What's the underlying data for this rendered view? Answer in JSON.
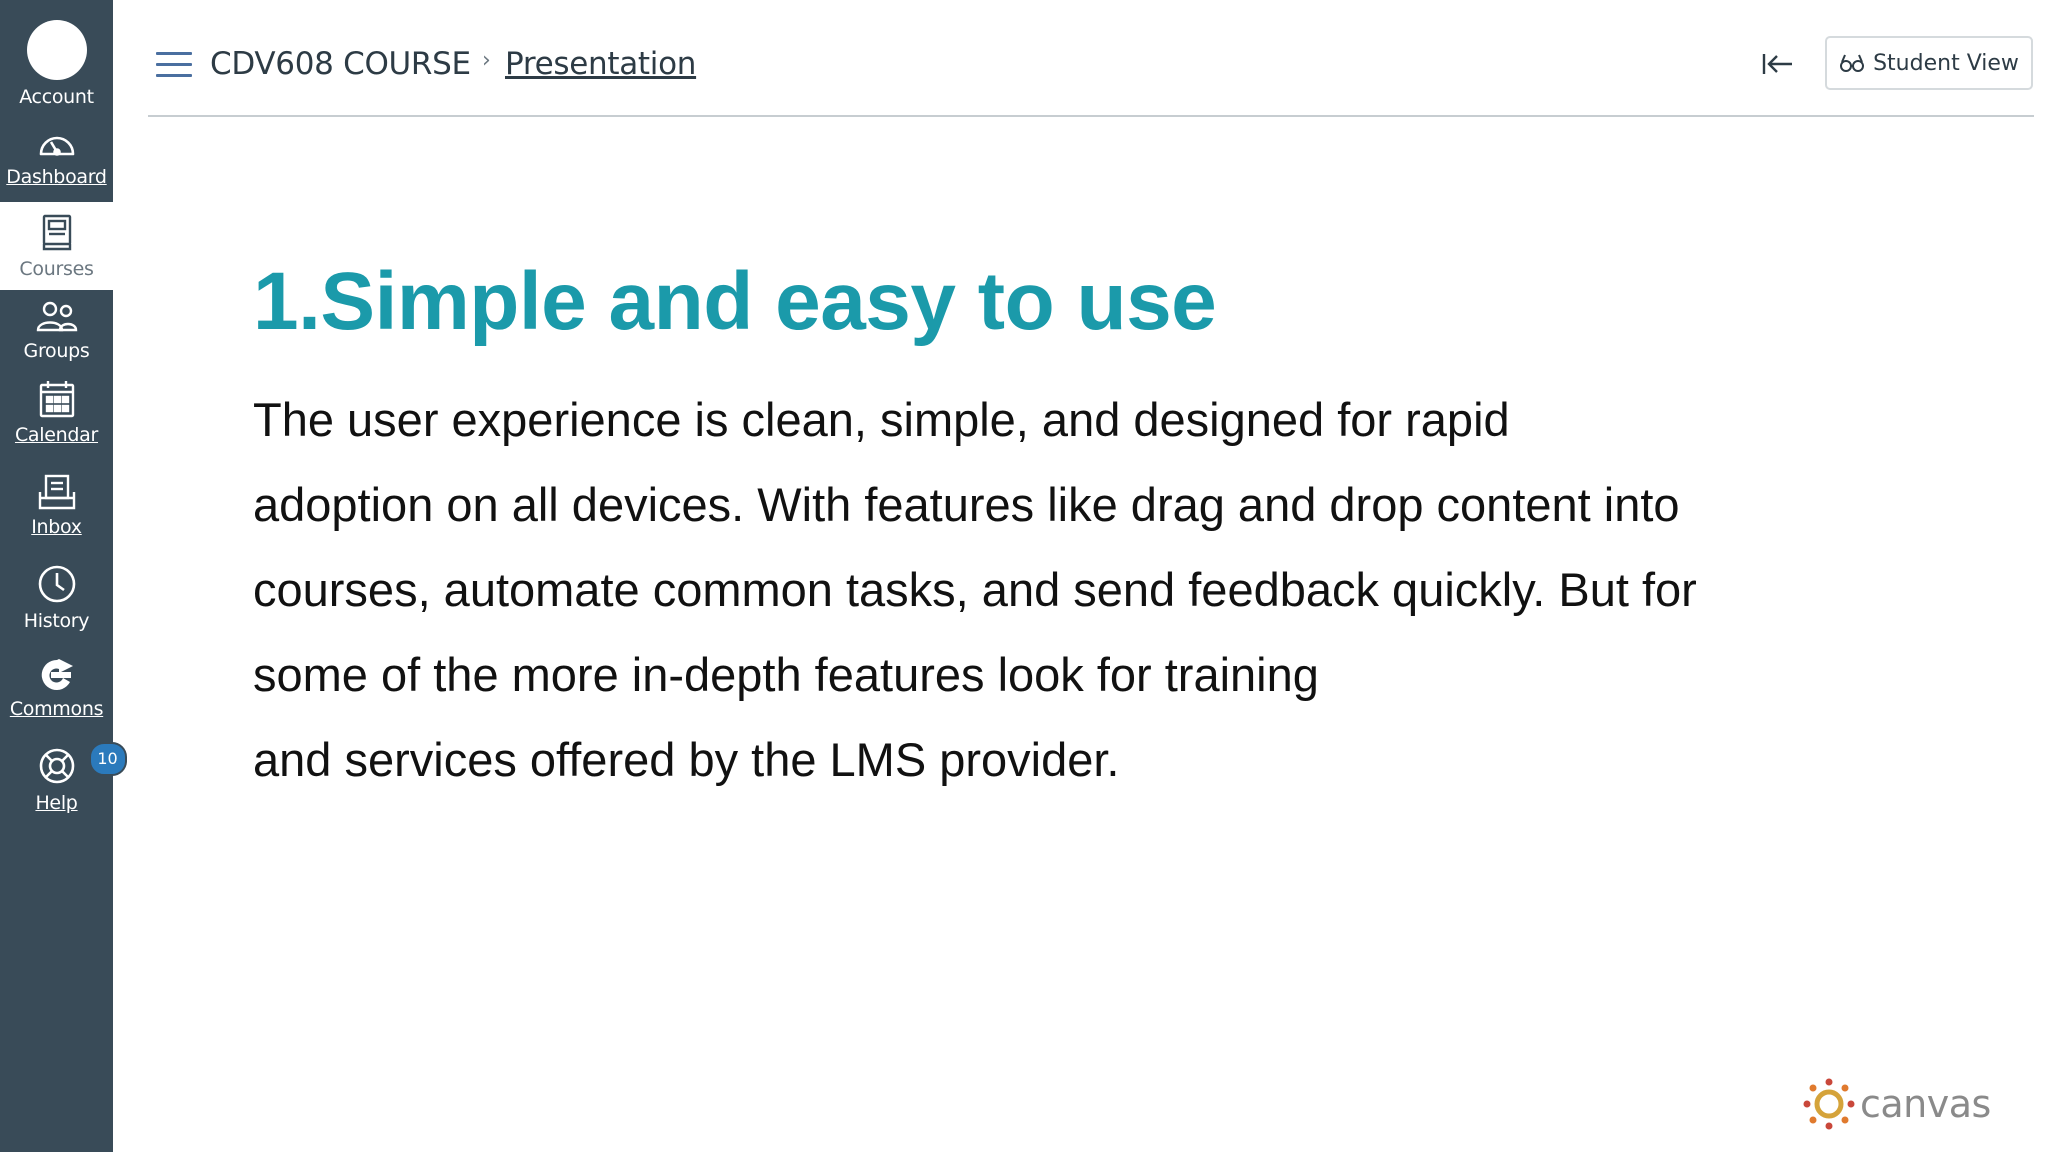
{
  "nav": {
    "items": [
      {
        "label": "Account",
        "icon": "avatar"
      },
      {
        "label": "Dashboard",
        "icon": "dashboard-icon"
      },
      {
        "label": "Courses",
        "icon": "courses-icon"
      },
      {
        "label": "Groups",
        "icon": "groups-icon"
      },
      {
        "label": "Calendar",
        "icon": "calendar-icon"
      },
      {
        "label": "Inbox",
        "icon": "inbox-icon"
      },
      {
        "label": "History",
        "icon": "history-icon"
      },
      {
        "label": "Commons",
        "icon": "commons-icon"
      },
      {
        "label": "Help",
        "icon": "help-icon",
        "badge": "10"
      }
    ],
    "active": "Courses",
    "background": "#394b58"
  },
  "header": {
    "course": "CDV608 COURSE",
    "separator": "›",
    "page": "Presentation",
    "student_view_label": "Student View"
  },
  "content": {
    "title": "1.Simple and easy to use",
    "title_color": "#1b9aaa",
    "lines": [
      "The user experience is clean, simple, and designed for rapid",
      "adoption on all devices. With features like drag and drop content into",
      "courses, automate common tasks, and send feedback quickly. But for",
      "some of the more in-depth features look for training",
      "and services offered by the LMS provider."
    ]
  },
  "logo": {
    "word": "canvas"
  }
}
